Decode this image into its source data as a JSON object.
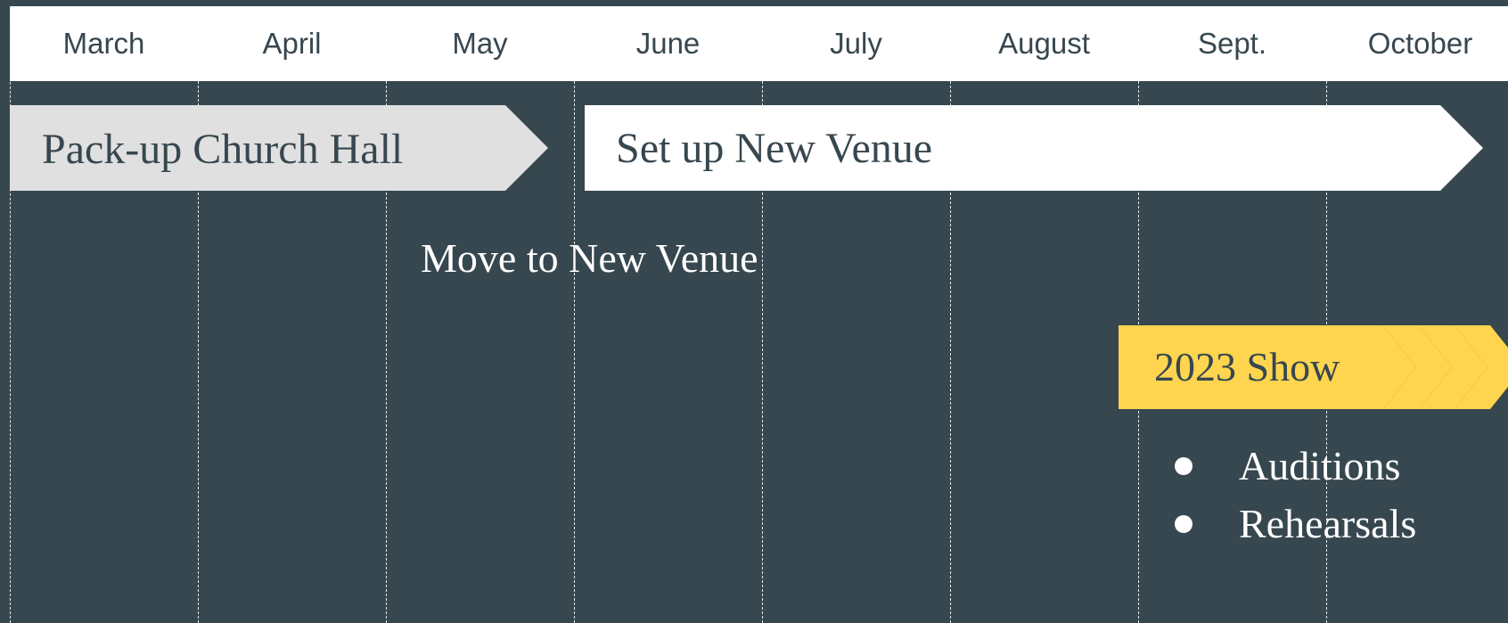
{
  "months": [
    "March",
    "April",
    "May",
    "June",
    "July",
    "August",
    "Sept.",
    "October"
  ],
  "tasks": {
    "pack_up": "Pack-up Church Hall",
    "set_up": "Set up New Venue",
    "move": "Move to New Venue",
    "show": "2023 Show"
  },
  "show_items": [
    "Auditions",
    "Rehearsals"
  ],
  "colors": {
    "background": "#37474f",
    "header": "#ffffff",
    "pack_up_fill": "#e0e0e0",
    "set_up_fill": "#ffffff",
    "show_fill": "#ffd54f",
    "text_dark": "#37474f"
  }
}
